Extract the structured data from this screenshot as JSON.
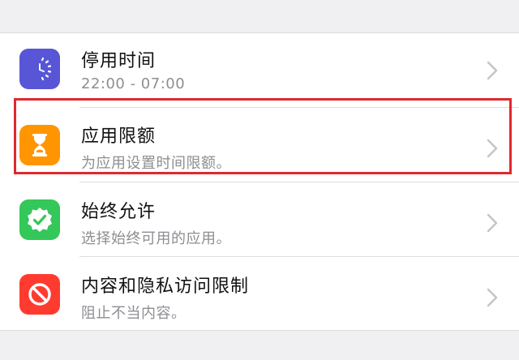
{
  "settings": {
    "items": [
      {
        "title": "停用时间",
        "subtitle": "22:00 - 07:00",
        "icon": "downtime-icon",
        "icon_color": "#5856d6"
      },
      {
        "title": "应用限额",
        "subtitle": "为应用设置时间限额。",
        "icon": "hourglass-icon",
        "icon_color": "#ff9500"
      },
      {
        "title": "始终允许",
        "subtitle": "选择始终可用的应用。",
        "icon": "checkmark-seal-icon",
        "icon_color": "#34c759"
      },
      {
        "title": "内容和隐私访问限制",
        "subtitle": "阻止不当内容。",
        "icon": "restriction-icon",
        "icon_color": "#ff3b30"
      }
    ]
  },
  "highlight_color": "#e0282e"
}
